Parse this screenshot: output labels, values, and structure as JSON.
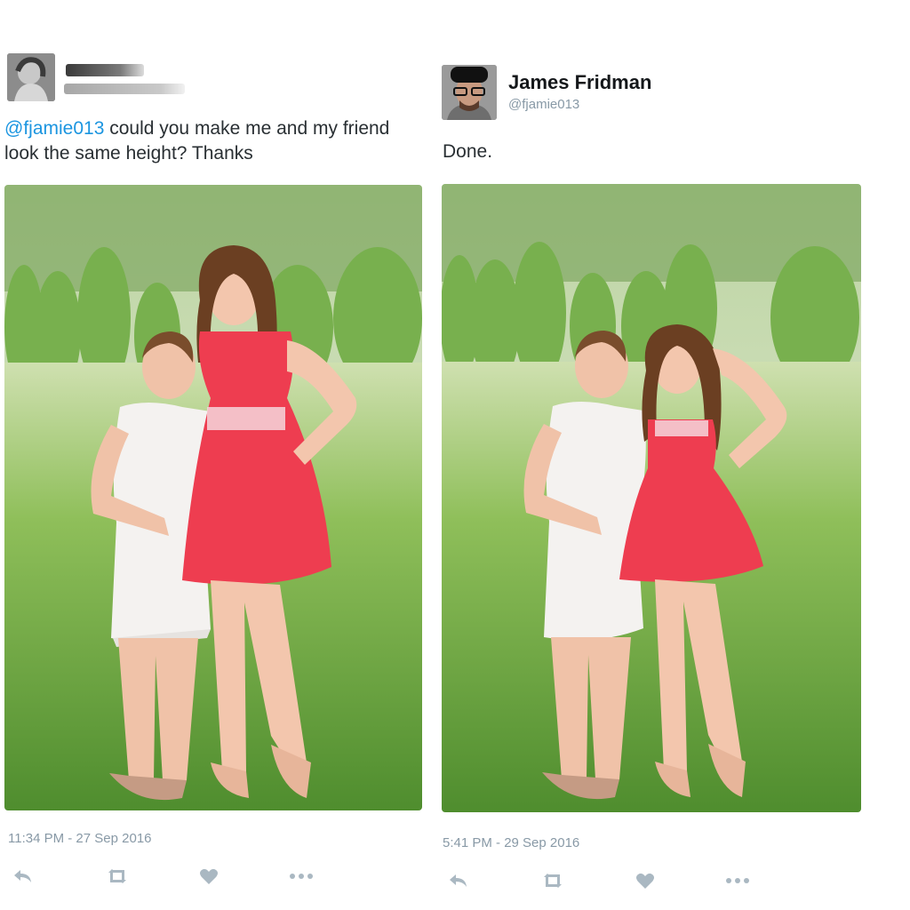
{
  "left_tweet": {
    "text_mention": "@fjamie013",
    "text_body": " could you make me and my friend look the same height? Thanks",
    "timestamp": "11:34 PM - 27 Sep 2016",
    "actions": [
      "reply-icon",
      "retweet-icon",
      "like-icon",
      "more-icon"
    ]
  },
  "right_tweet": {
    "display_name": "James Fridman",
    "handle": "@fjamie013",
    "text": "Done.",
    "timestamp": "5:41 PM - 29 Sep 2016",
    "actions": [
      "reply-icon",
      "retweet-icon",
      "like-icon",
      "more-icon"
    ]
  },
  "colors": {
    "mention": "#1b95e0",
    "meta_gray": "#8899a6",
    "icon_gray": "#aab8c2",
    "red_dress": "#ee3d50"
  }
}
